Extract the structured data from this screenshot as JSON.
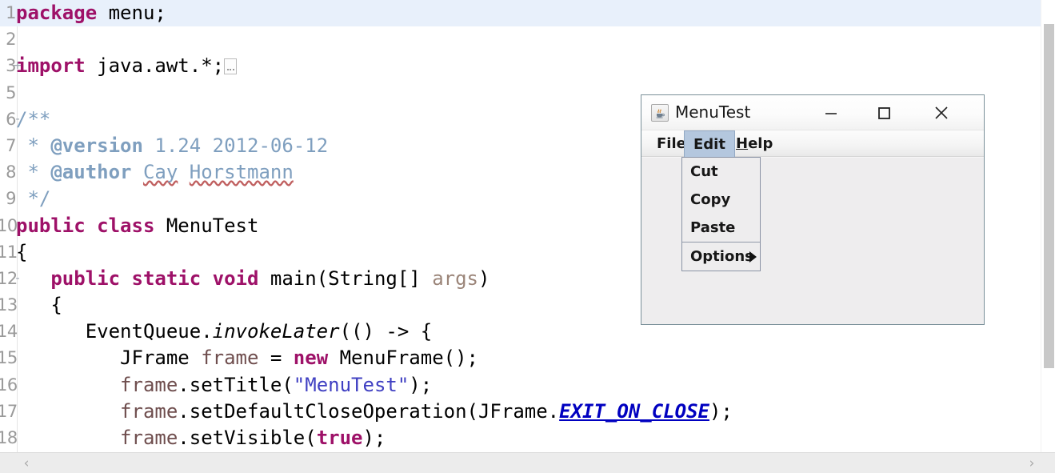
{
  "editor": {
    "lines": [
      {
        "num": "1",
        "fold": "",
        "current": true,
        "tokens": [
          {
            "t": "package ",
            "c": "kw"
          },
          {
            "t": "menu;",
            "c": "plain"
          }
        ]
      },
      {
        "num": "2",
        "fold": "",
        "current": false,
        "tokens": []
      },
      {
        "num": "3",
        "fold": "+",
        "current": false,
        "tokens": [
          {
            "t": "import ",
            "c": "kw"
          },
          {
            "t": "java.awt.*;",
            "c": "plain"
          },
          {
            "t": "[FOLDBOX]",
            "c": "foldbox"
          }
        ]
      },
      {
        "num": "5",
        "fold": "",
        "current": false,
        "tokens": []
      },
      {
        "num": "6",
        "fold": "-",
        "current": false,
        "tokens": [
          {
            "t": "/**",
            "c": "cmt"
          }
        ]
      },
      {
        "num": "7",
        "fold": "",
        "current": false,
        "tokens": [
          {
            "t": " * ",
            "c": "cmt"
          },
          {
            "t": "@version",
            "c": "cmt-tag"
          },
          {
            "t": " 1.24 2012-06-12",
            "c": "cmt"
          }
        ]
      },
      {
        "num": "8",
        "fold": "",
        "current": false,
        "tokens": [
          {
            "t": " * ",
            "c": "cmt"
          },
          {
            "t": "@author",
            "c": "cmt-tag"
          },
          {
            "t": " ",
            "c": "cmt"
          },
          {
            "t": "Cay",
            "c": "cmt spell-ul"
          },
          {
            "t": " ",
            "c": "cmt"
          },
          {
            "t": "Horstmann",
            "c": "cmt spell-ul"
          }
        ]
      },
      {
        "num": "9",
        "fold": "",
        "current": false,
        "tokens": [
          {
            "t": " */",
            "c": "cmt"
          }
        ]
      },
      {
        "num": "10",
        "fold": "",
        "current": false,
        "tokens": [
          {
            "t": "public class ",
            "c": "kw"
          },
          {
            "t": "MenuTest",
            "c": "plain"
          }
        ]
      },
      {
        "num": "11",
        "fold": "",
        "current": false,
        "tokens": [
          {
            "t": "{",
            "c": "plain"
          }
        ]
      },
      {
        "num": "12",
        "fold": "-",
        "current": false,
        "tokens": [
          {
            "t": "   ",
            "c": "plain"
          },
          {
            "t": "public static void ",
            "c": "kw"
          },
          {
            "t": "main(String[] ",
            "c": "plain"
          },
          {
            "t": "args",
            "c": "param"
          },
          {
            "t": ")",
            "c": "plain"
          }
        ]
      },
      {
        "num": "13",
        "fold": "",
        "current": false,
        "tokens": [
          {
            "t": "   {",
            "c": "plain"
          }
        ]
      },
      {
        "num": "14",
        "fold": "",
        "current": false,
        "tokens": [
          {
            "t": "      EventQueue.",
            "c": "plain"
          },
          {
            "t": "invokeLater",
            "c": "mth"
          },
          {
            "t": "(() -> {",
            "c": "plain"
          }
        ]
      },
      {
        "num": "15",
        "fold": "",
        "current": false,
        "tokens": [
          {
            "t": "         JFrame ",
            "c": "plain"
          },
          {
            "t": "frame",
            "c": "local"
          },
          {
            "t": " = ",
            "c": "plain"
          },
          {
            "t": "new ",
            "c": "kw"
          },
          {
            "t": "MenuFrame();",
            "c": "plain"
          }
        ]
      },
      {
        "num": "16",
        "fold": "",
        "current": false,
        "tokens": [
          {
            "t": "         ",
            "c": "plain"
          },
          {
            "t": "frame",
            "c": "local"
          },
          {
            "t": ".setTitle(",
            "c": "plain"
          },
          {
            "t": "\"MenuTest\"",
            "c": "str"
          },
          {
            "t": ");",
            "c": "plain"
          }
        ]
      },
      {
        "num": "17",
        "fold": "",
        "current": false,
        "tokens": [
          {
            "t": "         ",
            "c": "plain"
          },
          {
            "t": "frame",
            "c": "local"
          },
          {
            "t": ".setDefaultCloseOperation(JFrame.",
            "c": "plain"
          },
          {
            "t": "EXIT_ON_CLOSE",
            "c": "fld"
          },
          {
            "t": ");",
            "c": "plain"
          }
        ]
      },
      {
        "num": "18",
        "fold": "",
        "current": false,
        "tokens": [
          {
            "t": "         ",
            "c": "plain"
          },
          {
            "t": "frame",
            "c": "local"
          },
          {
            "t": ".setVisible(",
            "c": "plain"
          },
          {
            "t": "true",
            "c": "kw"
          },
          {
            "t": ");",
            "c": "plain"
          }
        ]
      }
    ],
    "hscroll": {
      "left_arrow": "‹",
      "right_arrow": "›"
    }
  },
  "swing_window": {
    "title": "MenuTest",
    "icon": "java-coffee-cup-icon",
    "buttons": {
      "minimize": "minimize-icon",
      "maximize": "maximize-icon",
      "close": "close-icon"
    },
    "menubar": [
      {
        "label": "File",
        "mnemonic": "",
        "selected": false
      },
      {
        "label": "Edit",
        "mnemonic": "",
        "selected": true
      },
      {
        "label": "Help",
        "mnemonic": "H",
        "selected": false
      }
    ],
    "popup_menu": {
      "owner": "Edit",
      "items": [
        {
          "label": "Cut",
          "submenu": false,
          "separator_after": false
        },
        {
          "label": "Copy",
          "submenu": false,
          "separator_after": false
        },
        {
          "label": "Paste",
          "submenu": false,
          "separator_after": true
        },
        {
          "label": "Options",
          "submenu": true,
          "separator_after": false
        }
      ]
    }
  },
  "colors": {
    "keyword": "#9e1168",
    "comment": "#7f9fbf",
    "string": "#4040c2",
    "static_field": "#0000c0",
    "current_line": "#e8f0fb",
    "menu_selected": "#b4c7de",
    "window_bg": "#eeedee"
  }
}
